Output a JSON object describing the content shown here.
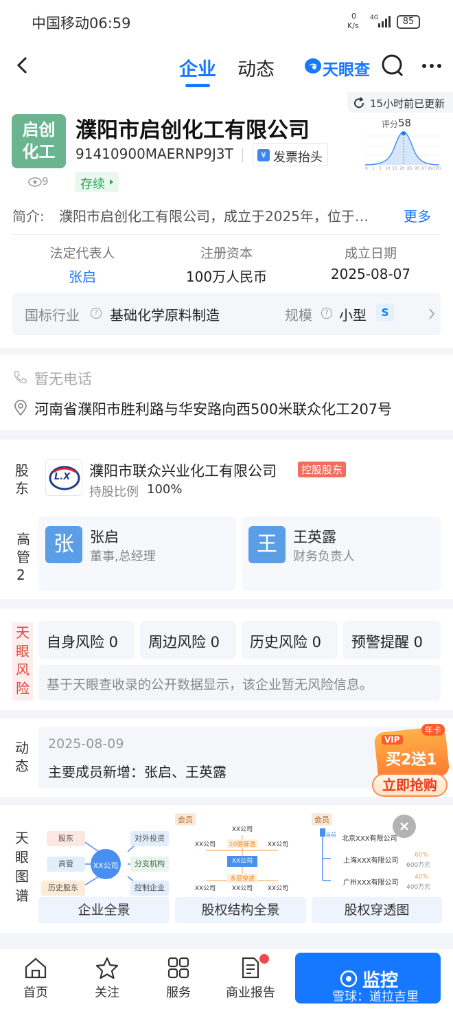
{
  "status_bar": {
    "carrier_time": "中国移动06:59",
    "net_speed_value": "0",
    "net_speed_unit": "K/s",
    "signal": "4G",
    "battery": "85"
  },
  "nav": {
    "tab_company": "企业",
    "tab_news": "动态",
    "brand": "天眼查"
  },
  "update": {
    "text": "15小时前已更新"
  },
  "company": {
    "logo_text": "启创\n化工",
    "name": "濮阳市启创化工有限公司",
    "credit_code": "91410900MAERNP9J3T",
    "invoice_label": "发票抬头",
    "views": "9",
    "status": "存续",
    "score_label": "评分",
    "score_value": "58",
    "score_axis": [
      "0",
      "1",
      "5",
      "10",
      "15",
      "20",
      "85",
      "95",
      "97",
      "99",
      "100"
    ]
  },
  "intro": {
    "prefix": "简介:",
    "text": "濮阳市启创化工有限公司，成立于2025年，位于…",
    "more": "更多"
  },
  "basic": {
    "rep_label": "法定代表人",
    "rep_value": "张启",
    "capital_label": "注册资本",
    "capital_value": "100万人民币",
    "date_label": "成立日期",
    "date_value": "2025-08-07",
    "industry_label": "国标行业",
    "industry_value": "基础化学原料制造",
    "scale_label": "规模",
    "scale_value": "小型",
    "scale_badge": "S"
  },
  "contact": {
    "phone": "暂无电话",
    "address": "河南省濮阳市胜利路与华安路向西500米联众化工207号"
  },
  "shareholder": {
    "section_label": "股\n东",
    "logo_text": "L.X",
    "name": "濮阳市联众兴业化工有限公司",
    "tag": "控股股东",
    "ratio_label": "持股比例",
    "ratio_value": "100%"
  },
  "executives": {
    "section_label": "高\n管\n2",
    "items": [
      {
        "avatar": "张",
        "name": "张启",
        "role": "董事,总经理"
      },
      {
        "avatar": "王",
        "name": "王英露",
        "role": "财务负责人"
      }
    ]
  },
  "risk": {
    "section_label": "天\n眼\n风\n险",
    "items": [
      "自身风险 0",
      "周边风险 0",
      "历史风险 0",
      "预警提醒 0"
    ],
    "message": "基于天眼查收录的公开数据显示，该企业暂无风险信息。"
  },
  "news": {
    "section_label": "动\n态",
    "date": "2025-08-09",
    "text": "主要成员新增：张启、王英露",
    "promo_year": "年卡",
    "promo_vip": "VIP",
    "promo_main": "买2送1",
    "promo_cta": "立即抢购"
  },
  "graph": {
    "section_label": "天\n眼\n图\n谱",
    "cards": [
      {
        "title": "企业全景",
        "center": "XX公司",
        "left": [
          "股东",
          "高管",
          "历史股东"
        ],
        "right": [
          "对外投资",
          "分支机构",
          "控制企业"
        ]
      },
      {
        "title": "股权结构全景",
        "badge": "会员",
        "nodes": [
          "XX公司",
          "XX公司",
          "10层穿透",
          "XX公司",
          "XX公司",
          "多层穿透",
          "XX公司",
          "XX公司",
          "XX公司"
        ]
      },
      {
        "title": "股权穿透图",
        "badge": "会员",
        "rows": [
          "北京XXX有限公司",
          "上海XXX有限公司",
          "广州XXX有限公司"
        ],
        "tag": "当前",
        "pct": [
          "60%",
          "40%"
        ],
        "amt": [
          "600万元",
          "400万元"
        ]
      }
    ]
  },
  "bottom": {
    "home": "首页",
    "follow": "关注",
    "service": "服务",
    "report": "商业报告",
    "monitor": "监控",
    "watermark": "雪球：道拉吉里"
  }
}
